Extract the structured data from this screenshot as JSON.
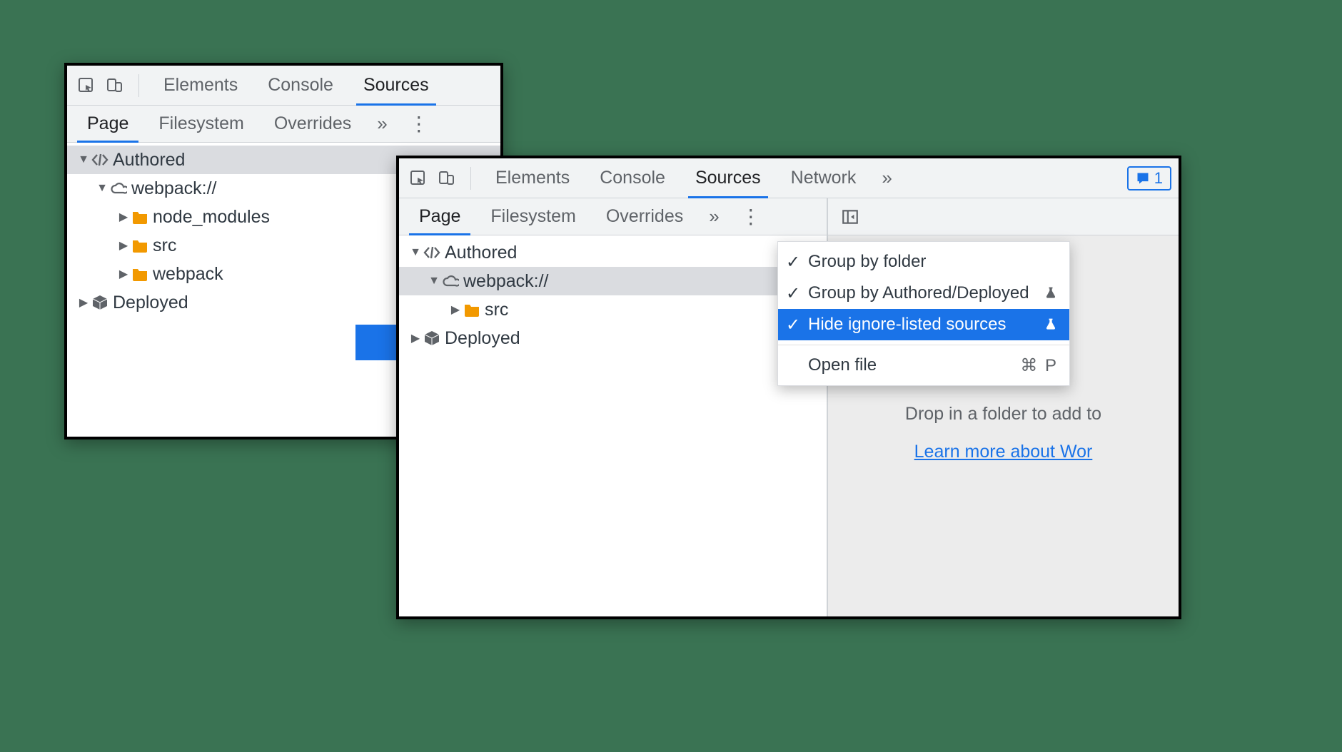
{
  "panelA": {
    "tabs": {
      "elements": "Elements",
      "console": "Console",
      "sources": "Sources"
    },
    "subtabs": {
      "page": "Page",
      "filesystem": "Filesystem",
      "overrides": "Overrides"
    },
    "tree": {
      "authored": "Authored",
      "webpack": "webpack://",
      "node_modules": "node_modules",
      "src": "src",
      "webpack_folder": "webpack",
      "deployed": "Deployed"
    }
  },
  "panelB": {
    "tabs": {
      "elements": "Elements",
      "console": "Console",
      "sources": "Sources",
      "network": "Network"
    },
    "issues_count": "1",
    "subtabs": {
      "page": "Page",
      "filesystem": "Filesystem",
      "overrides": "Overrides"
    },
    "tree": {
      "authored": "Authored",
      "webpack": "webpack://",
      "src": "src",
      "deployed": "Deployed"
    },
    "menu": {
      "group_folder": "Group by folder",
      "group_authored": "Group by Authored/Deployed",
      "hide_ignore": "Hide ignore-listed sources",
      "open_file": "Open file",
      "open_file_shortcut": "⌘ P"
    },
    "placeholder": {
      "drop": "Drop in a folder to add to",
      "learn": "Learn more about Wor"
    }
  }
}
